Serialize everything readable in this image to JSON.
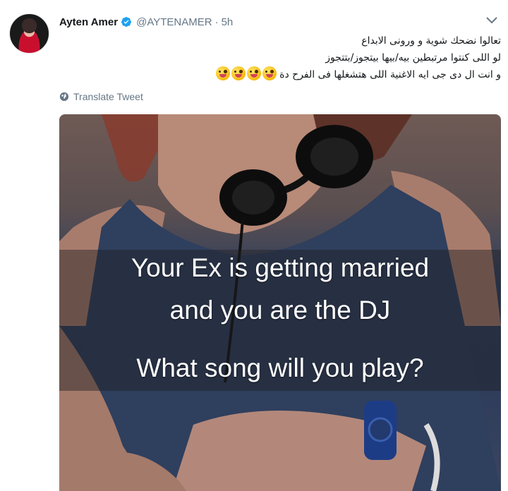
{
  "author": {
    "name": "Ayten Amer",
    "handle": "@AYTENAMER",
    "separator": "·",
    "time": "5h",
    "verified": true
  },
  "tweet": {
    "lines": [
      "تعالوا نضحك شوية و ورونى الابداع",
      "لو اللى كنتوا مرتبطين بيه/بيها بيتجوز/بتتجوز",
      "و انت ال دى جى ايه الاغنية اللى هتشغلها فى الفرح دة"
    ],
    "emoji_count": 4,
    "emoji_name": "zany-face-icon"
  },
  "translate": {
    "label": "Translate Tweet",
    "icon": "globe-icon"
  },
  "media": {
    "caption_line1": "Your Ex is getting married",
    "caption_line2": "and you are the DJ",
    "caption_line3": "What song will you play?"
  },
  "colors": {
    "text": "#14171a",
    "muted": "#657786",
    "verified": "#1da1f2"
  }
}
